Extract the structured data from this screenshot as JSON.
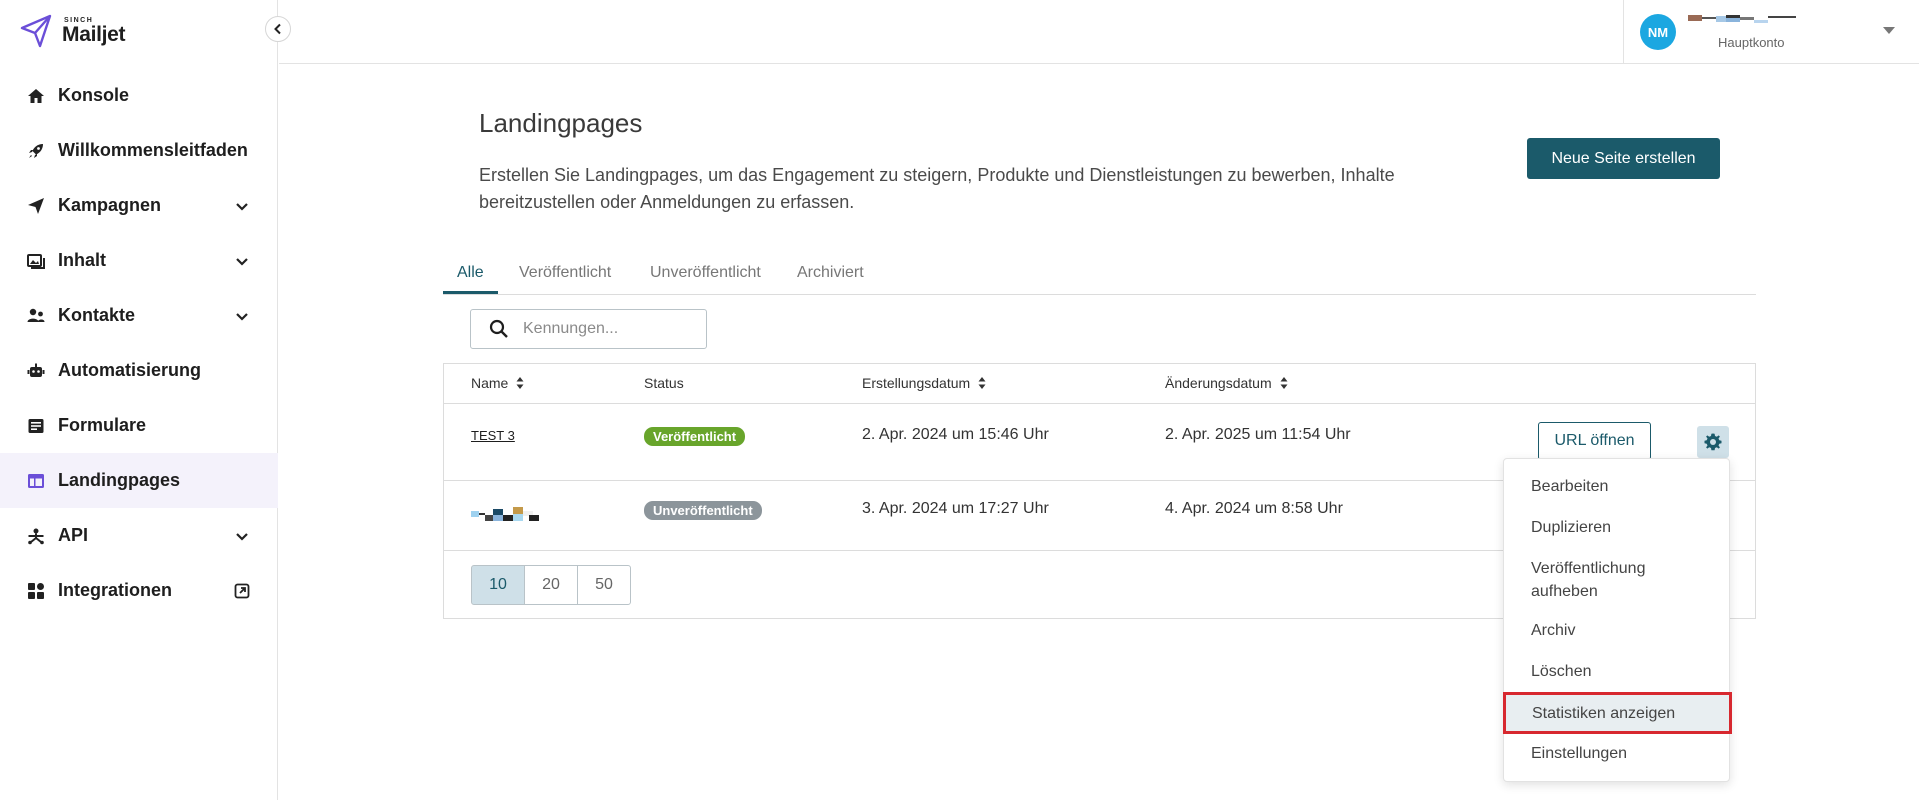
{
  "brand": {
    "small": "SINCH",
    "name": "Mailjet",
    "accent": "#6b4fd8"
  },
  "sidebar": {
    "items": [
      {
        "label": "Konsole",
        "icon": "home-icon",
        "chevron": false
      },
      {
        "label": "Willkommensleitfaden",
        "icon": "rocket-icon",
        "chevron": false
      },
      {
        "label": "Kampagnen",
        "icon": "send-icon",
        "chevron": true
      },
      {
        "label": "Inhalt",
        "icon": "image-icon",
        "chevron": true
      },
      {
        "label": "Kontakte",
        "icon": "contacts-icon",
        "chevron": true
      },
      {
        "label": "Automatisierung",
        "icon": "robot-icon",
        "chevron": false
      },
      {
        "label": "Formulare",
        "icon": "form-icon",
        "chevron": false
      },
      {
        "label": "Landingpages",
        "icon": "landing-icon",
        "chevron": false,
        "active": true
      },
      {
        "label": "API",
        "icon": "api-icon",
        "chevron": true
      },
      {
        "label": "Integrationen",
        "icon": "grid-icon",
        "chevron": false,
        "external": true
      }
    ]
  },
  "account": {
    "initials": "NM",
    "subtitle": "Hauptkonto",
    "avatar_color": "#1ba7e1"
  },
  "main": {
    "title": "Landingpages",
    "description": "Erstellen Sie Landingpages, um das Engagement zu steigern, Produkte und Dienstleistungen zu bewerben, Inhalte bereitzustellen oder Anmeldungen zu erfassen.",
    "new_button": "Neue Seite erstellen",
    "tabs": [
      "Alle",
      "Veröffentlicht",
      "Unveröffentlicht",
      "Archiviert"
    ],
    "search_placeholder": "Kennungen..."
  },
  "table": {
    "headers": {
      "name": "Name",
      "status": "Status",
      "created": "Erstellungsdatum",
      "modified": "Änderungsdatum"
    },
    "rows": [
      {
        "name": "TEST 3",
        "status": "Veröffentlicht",
        "created": "2. Apr. 2024 um 15:46 Uhr",
        "modified": "2. Apr. 2025 um 11:54 Uhr",
        "action": "URL öffnen"
      },
      {
        "name": "",
        "status": "Unveröffentlicht",
        "created": "3. Apr. 2024 um 17:27 Uhr",
        "modified": "4. Apr. 2024 um 8:58 Uhr"
      }
    ],
    "page_sizes": [
      "10",
      "20",
      "50"
    ]
  },
  "menu": {
    "items": [
      "Bearbeiten",
      "Duplizieren",
      "Veröffentlichung aufheben",
      "Archiv",
      "Löschen",
      "Statistiken anzeigen",
      "Einstellungen"
    ]
  },
  "colors": {
    "primary": "#1b5a6a",
    "published": "#68a52b",
    "unpublished": "#8c959b",
    "highlight": "#d7282f"
  }
}
